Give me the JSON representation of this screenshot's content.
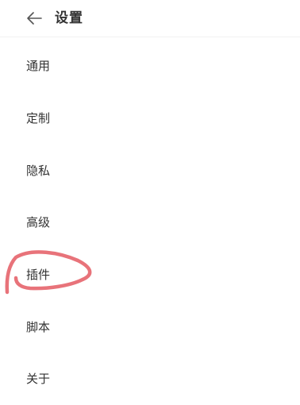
{
  "header": {
    "back_icon": "arrow-left-icon",
    "title": "设置"
  },
  "menu": {
    "items": [
      {
        "label": "通用"
      },
      {
        "label": "定制"
      },
      {
        "label": "隐私"
      },
      {
        "label": "高级"
      },
      {
        "label": "插件"
      },
      {
        "label": "脚本"
      },
      {
        "label": "关于"
      }
    ]
  },
  "annotation": {
    "color": "#e8737a",
    "target": "插件"
  }
}
